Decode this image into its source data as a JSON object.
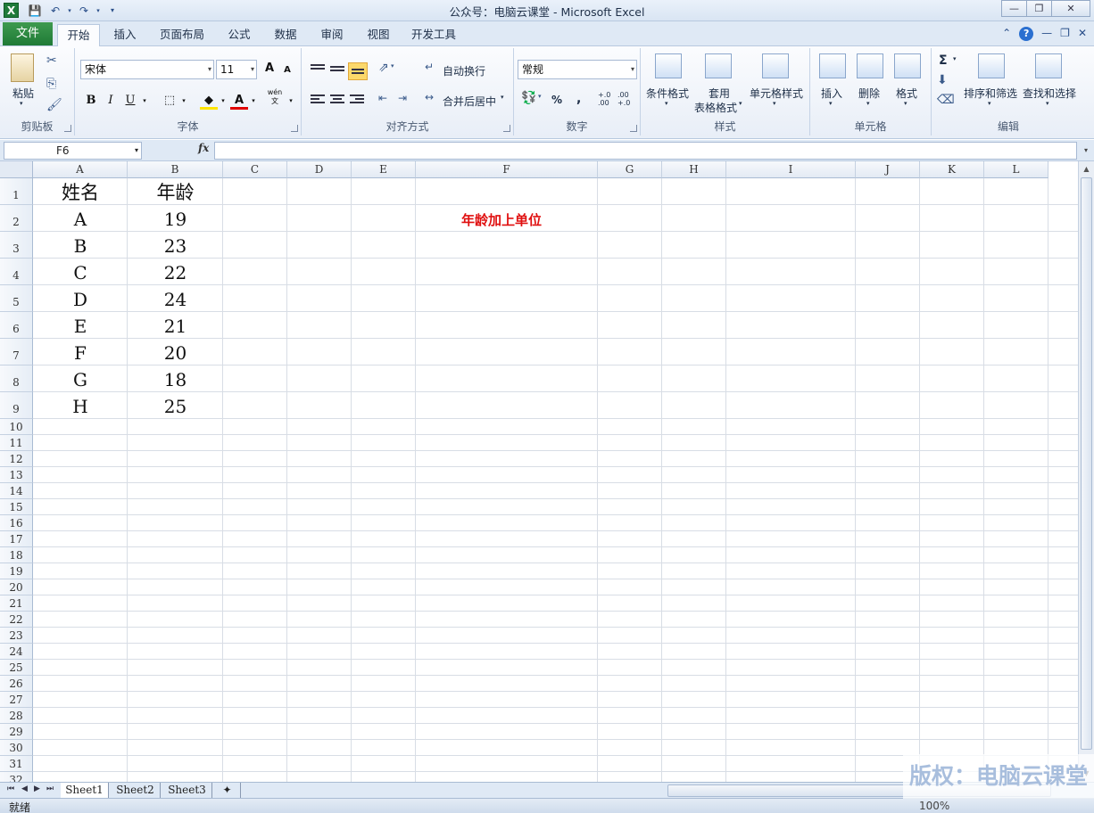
{
  "window": {
    "title": "公众号：电脑云课堂 - Microsoft Excel",
    "app_icon": "excel-icon"
  },
  "tabs": {
    "file": "文件",
    "items": [
      "开始",
      "插入",
      "页面布局",
      "公式",
      "数据",
      "审阅",
      "视图",
      "开发工具"
    ],
    "active": "开始"
  },
  "ribbon": {
    "clipboard": {
      "label": "剪贴板",
      "paste": "粘贴"
    },
    "font": {
      "label": "字体",
      "name": "宋体",
      "size": "11",
      "bold": "B",
      "italic": "I",
      "underline": "U",
      "grow": "A",
      "shrink": "A",
      "color_letter": "A",
      "wen": "wén",
      "wen_char": "文"
    },
    "alignment": {
      "label": "对齐方式",
      "wrap": "自动换行",
      "merge": "合并后居中"
    },
    "number": {
      "label": "数字",
      "format": "常规",
      "percent": "%",
      "comma": ",",
      "inc_decimal": "+.0 .00",
      "dec_decimal": ".00 +.0"
    },
    "styles": {
      "label": "样式",
      "conditional": "条件格式",
      "table_line1": "套用",
      "table_line2": "表格格式",
      "cell_styles": "单元格样式"
    },
    "cells": {
      "label": "单元格",
      "insert": "插入",
      "delete": "删除",
      "format": "格式"
    },
    "editing": {
      "label": "编辑",
      "sum": "Σ",
      "sort_filter": "排序和筛选",
      "find_select": "查找和选择"
    }
  },
  "formula_bar": {
    "name_box": "F6",
    "fx": "fx",
    "content": ""
  },
  "columns": [
    "A",
    "B",
    "C",
    "D",
    "E",
    "F",
    "G",
    "H",
    "I",
    "J",
    "K",
    "L"
  ],
  "rows": [
    "1",
    "2",
    "3",
    "4",
    "5",
    "6",
    "7",
    "8",
    "9",
    "10",
    "11",
    "12",
    "13",
    "14",
    "15",
    "16",
    "17",
    "18",
    "19",
    "20",
    "21",
    "22",
    "23",
    "24",
    "25",
    "26",
    "27",
    "28",
    "29",
    "30",
    "31",
    "32"
  ],
  "table": {
    "header_name": "姓名",
    "header_age": "年龄",
    "names": [
      "A",
      "B",
      "C",
      "D",
      "E",
      "F",
      "G",
      "H"
    ],
    "ages": [
      "19",
      "23",
      "22",
      "24",
      "21",
      "20",
      "18",
      "25"
    ]
  },
  "note": {
    "text": "年龄加上单位",
    "color": "#e01010"
  },
  "sheets": [
    "Sheet1",
    "Sheet2",
    "Sheet3"
  ],
  "active_sheet": "Sheet1",
  "status": {
    "ready": "就绪",
    "zoom": "100%"
  },
  "watermark": "版权：电脑云课堂",
  "colors": {
    "file_tab": "#1f7a36",
    "selected_align": "#fbd86a"
  }
}
